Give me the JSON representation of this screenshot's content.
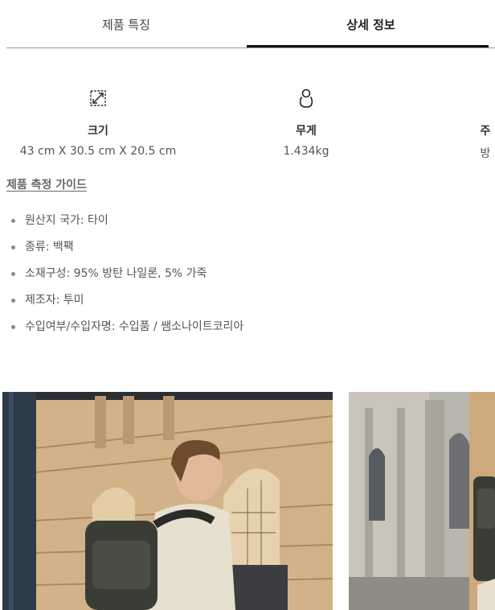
{
  "tabs": [
    {
      "label": "제품 특징",
      "active": false
    },
    {
      "label": "상세 정보",
      "active": true
    }
  ],
  "specs": [
    {
      "icon": "dimensions-icon",
      "label": "크기",
      "value": "43 cm X 30.5 cm X 20.5 cm"
    },
    {
      "icon": "weight-icon",
      "label": "무게",
      "value": "1.434kg"
    },
    {
      "icon": "material-icon",
      "label": "주",
      "value": "방"
    }
  ],
  "guide_link": "제품 측정 가이드",
  "details": [
    "원산지 국가: 타이",
    "종류: 백팩",
    "소재구성: 95% 방탄 나일론, 5% 가죽",
    "제조자: 투미",
    "수입여부/수입자명: 수입품 / 쌤소나이트코리아"
  ],
  "colors": {
    "active_underline": "#111111",
    "divider": "#9a9a9a",
    "text_muted": "#555555"
  }
}
